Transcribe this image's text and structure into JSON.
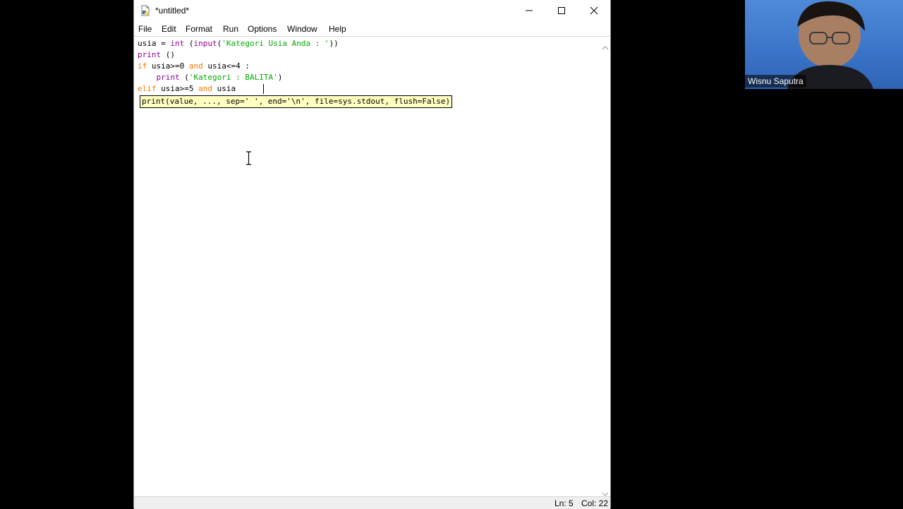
{
  "window": {
    "title": "*untitled*",
    "controls": {
      "minimize": "minimize",
      "maximize": "maximize",
      "close": "close"
    }
  },
  "menu": [
    "File",
    "Edit",
    "Format",
    "Run",
    "Options",
    "Window",
    "Help"
  ],
  "code": {
    "line1": {
      "a": "usia = ",
      "b": "int",
      "c": " (",
      "d": "input",
      "e": "(",
      "f": "'Kategori Usia Anda : '",
      "g": "))"
    },
    "line2": {
      "a": "print",
      "b": " ()"
    },
    "line3": {
      "a": "if",
      "b": " usia>=0 ",
      "c": "and",
      "d": " usia<=4 :"
    },
    "line4": {
      "a": "    ",
      "b": "print",
      "c": " (",
      "d": "'Kategori : BALITA'",
      "e": ")"
    },
    "line5": {
      "a": "elif",
      "b": " usia>=5 ",
      "c": "and",
      "d": " usia "
    }
  },
  "calltip": "print(value, ..., sep=' ', end='\\n', file=sys.stdout, flush=False)",
  "status": {
    "ln": "Ln: 5",
    "col": "Col: 22"
  },
  "video": {
    "participant": "Wisnu Saputra"
  },
  "colors": {
    "keyword": "#ff7700",
    "builtin": "#900090",
    "string": "#00aa00",
    "calltip_bg": "#ffffc0"
  }
}
